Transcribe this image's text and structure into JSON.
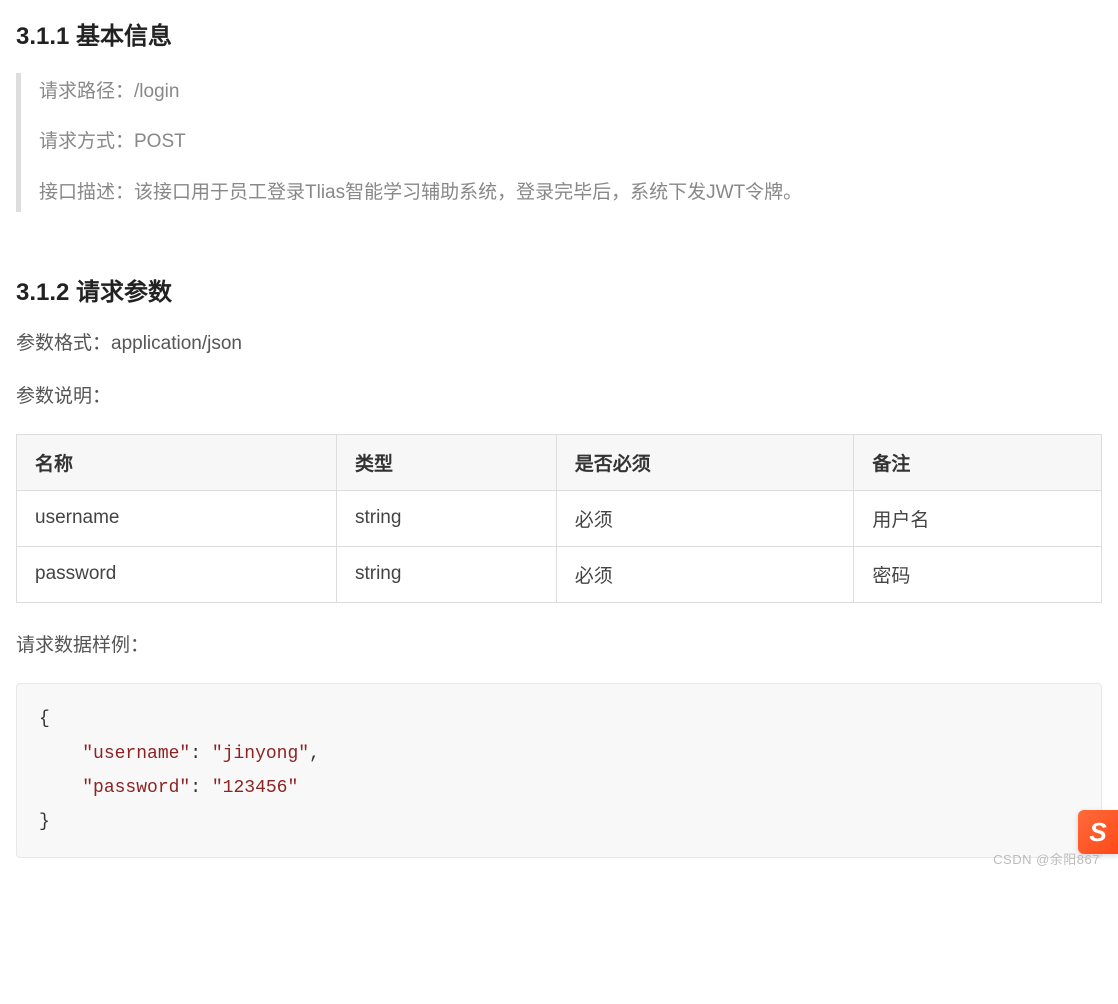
{
  "section1": {
    "heading": "3.1.1 基本信息",
    "items": [
      "请求路径：/login",
      "请求方式：POST",
      "接口描述：该接口用于员工登录Tlias智能学习辅助系统，登录完毕后，系统下发JWT令牌。"
    ]
  },
  "section2": {
    "heading": "3.1.2 请求参数",
    "param_format_label": "参数格式：application/json",
    "param_desc_label": "参数说明：",
    "table": {
      "headers": [
        "名称",
        "类型",
        "是否必须",
        "备注"
      ],
      "rows": [
        [
          "username",
          "string",
          "必须",
          "用户名"
        ],
        [
          "password",
          "string",
          "必须",
          "密码"
        ]
      ]
    },
    "sample_label": "请求数据样例：",
    "code": {
      "open_brace": "{",
      "lines": [
        {
          "key": "\"username\"",
          "colon": ": ",
          "value": "\"jinyong\"",
          "comma": ","
        },
        {
          "key": "\"password\"",
          "colon": ": ",
          "value": "\"123456\"",
          "comma": ""
        }
      ],
      "close_brace": "}"
    }
  },
  "watermark": "CSDN @余阳867",
  "sogou": "S"
}
